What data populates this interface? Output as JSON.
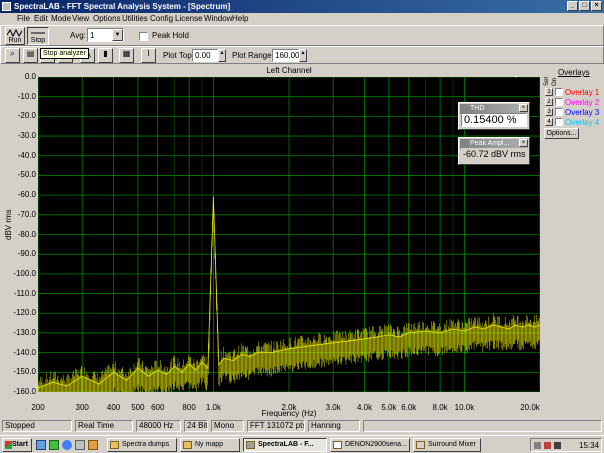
{
  "window": {
    "title": "SpectraLAB - FFT Spectral Analysis System - [Spectrum]"
  },
  "menu": [
    "File",
    "Edit",
    "Mode",
    "View",
    "Options",
    "Utilities",
    "Config",
    "License",
    "Window",
    "Help"
  ],
  "toolbar1": {
    "run_label": "Run",
    "stop_label": "Stop",
    "avg_label": "Avg:",
    "avg_value": "1",
    "peak_hold_label": "Peak Hold"
  },
  "toolbar2": {
    "tooltip": "Stop analyzer",
    "plot_top_label": "Plot Top:",
    "plot_top_value": "0.00",
    "plot_range_label": "Plot Range:",
    "plot_range_value": "160.00"
  },
  "chart": {
    "channel_title": "Left Channel"
  },
  "chart_data": {
    "type": "line",
    "title": "Left Channel",
    "xlabel": "Frequency (Hz)",
    "ylabel": "dBV rms",
    "xscale": "log",
    "xlim": [
      200,
      20000
    ],
    "ylim": [
      -160,
      0
    ],
    "grid": true,
    "y_ticks": [
      "0.0",
      "-10.0",
      "-20.0",
      "-30.0",
      "-40.0",
      "-50.0",
      "-60.0",
      "-70.0",
      "-80.0",
      "-90.0",
      "-100.0",
      "-110.0",
      "-120.0",
      "-130.0",
      "-140.0",
      "-150.0",
      "-160.0"
    ],
    "x_ticks": [
      {
        "label": "200",
        "v": 200
      },
      {
        "label": "300",
        "v": 300
      },
      {
        "label": "400",
        "v": 400
      },
      {
        "label": "500",
        "v": 500
      },
      {
        "label": "600",
        "v": 600
      },
      {
        "label": "800",
        "v": 800
      },
      {
        "label": "1.0k",
        "v": 1000
      },
      {
        "label": "2.0k",
        "v": 2000
      },
      {
        "label": "3.0k",
        "v": 3000
      },
      {
        "label": "4.0k",
        "v": 4000
      },
      {
        "label": "5.0k",
        "v": 5000
      },
      {
        "label": "6.0k",
        "v": 6000
      },
      {
        "label": "8.0k",
        "v": 8000
      },
      {
        "label": "10.0k",
        "v": 10000
      },
      {
        "label": "20.0k",
        "v": 20000
      }
    ],
    "series": [
      {
        "color": "#e8e800",
        "x": [
          200,
          230,
          260,
          300,
          350,
          400,
          450,
          500,
          550,
          600,
          650,
          700,
          750,
          800,
          850,
          900,
          950,
          1000,
          1050,
          1100,
          1200,
          1300,
          1400,
          1500,
          1700,
          2000,
          2300,
          2600,
          3000,
          3500,
          4000,
          4500,
          5000,
          5500,
          6000,
          7000,
          8000,
          9000,
          10000,
          11000,
          12000,
          13000,
          14000,
          15000,
          16000,
          17000,
          18000,
          19000,
          20000
        ],
        "y": [
          -158,
          -155,
          -157,
          -152,
          -156,
          -150,
          -154,
          -148,
          -152,
          -149,
          -151,
          -147,
          -150,
          -146,
          -149,
          -145,
          -148,
          -61,
          -146,
          -143,
          -144,
          -141,
          -142,
          -140,
          -140,
          -138,
          -137,
          -136,
          -135,
          -134,
          -133,
          -132,
          -131,
          -132,
          -130,
          -129,
          -130,
          -128,
          -129,
          -127,
          -128,
          -126,
          -127,
          -128,
          -126,
          -127,
          -126,
          -127,
          -126
        ]
      }
    ]
  },
  "thd": {
    "title": "THD",
    "value": "0.15400 %"
  },
  "peak": {
    "title": "Peak Ampl...",
    "value": "-60.72 dBV rms"
  },
  "overlays": {
    "title": "Overlays",
    "set_label": "Set",
    "on_label": "On",
    "items": [
      "Overlay 1",
      "Overlay 2",
      "Overlay 3",
      "Overlay 4"
    ],
    "colors": [
      "#ff0000",
      "#ff00ff",
      "#0000ff",
      "#00c0ff"
    ],
    "options_label": "Options..."
  },
  "status": {
    "state": "Stopped",
    "mode": "Real Time",
    "rate": "48000 Hz",
    "bits": "24 Bit",
    "channels": "Mono",
    "fft": "FFT 131072 pts",
    "window": "Hanning"
  },
  "taskbar": {
    "start": "Start",
    "tasks": [
      "Spectra dumps",
      "Ny mapp",
      "SpectraLAB - F...",
      "DENON2900sena...",
      "Surround Mixer"
    ],
    "clock": "15:34"
  }
}
